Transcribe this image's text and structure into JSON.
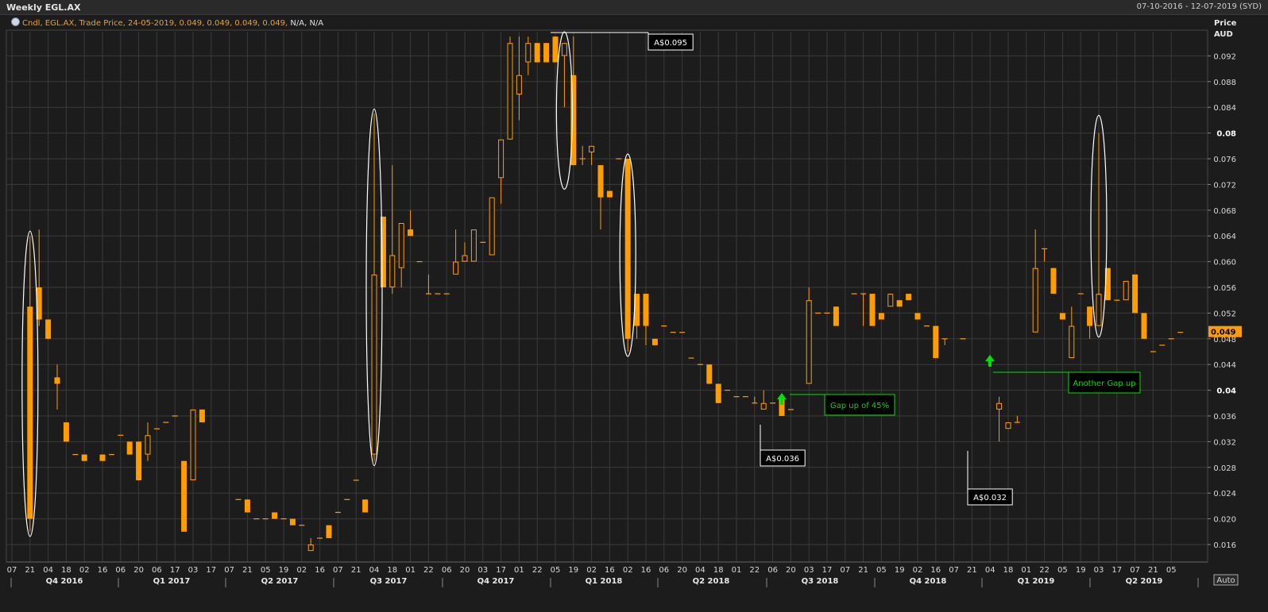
{
  "window": {
    "title": "Weekly EGL.AX",
    "date_range": "07-10-2016 - 12-07-2019 (SYD)"
  },
  "legend": {
    "icon": "chart-settings-icon",
    "series_text": "Cndl, EGL.AX, Trade Price, 24-05-2019, 0.049, 0.049, 0.049, 0.049,",
    "na_text": " N/A, N/A"
  },
  "axis": {
    "y_header_1": "Price",
    "y_header_2": "AUD",
    "auto_label": "Auto",
    "last_price_label": "0.049"
  },
  "colors": {
    "background": "#1c1c1c",
    "grid": "#3a3a3a",
    "candle": "#ff9d00",
    "annotation_green": "#00e000",
    "annotation_white": "#ffffff"
  },
  "chart_data": {
    "type": "candlestick",
    "title": "Weekly EGL.AX",
    "ylabel": "Price AUD",
    "ylim": [
      0.014,
      0.096
    ],
    "yticks": [
      0.016,
      0.02,
      0.024,
      0.028,
      0.032,
      0.036,
      0.04,
      0.044,
      0.048,
      0.052,
      0.056,
      0.06,
      0.064,
      0.068,
      0.072,
      0.076,
      0.08,
      0.084,
      0.088,
      0.092
    ],
    "yticks_bold": [
      0.04,
      0.08
    ],
    "grid": true,
    "xticks": [
      "07",
      "21",
      "04",
      "18",
      "02",
      "16",
      "06",
      "20",
      "06",
      "17",
      "03",
      "17",
      "07",
      "21",
      "05",
      "19",
      "02",
      "16",
      "07",
      "21",
      "04",
      "18",
      "01",
      "22",
      "06",
      "20",
      "03",
      "17",
      "01",
      "22",
      "05",
      "19",
      "02",
      "16",
      "02",
      "16",
      "06",
      "20",
      "04",
      "18",
      "01",
      "22",
      "06",
      "20",
      "03",
      "17",
      "07",
      "21",
      "05",
      "19",
      "02",
      "16",
      "07",
      "21",
      "04",
      "18",
      "01",
      "22",
      "05",
      "19",
      "03",
      "17",
      "07",
      "21",
      "05"
    ],
    "quarters": [
      "Q4 2016",
      "Q1 2017",
      "Q2 2017",
      "Q3 2017",
      "Q4 2017",
      "Q1 2018",
      "Q2 2018",
      "Q3 2018",
      "Q4 2018",
      "Q1 2019",
      "Q2 2019"
    ],
    "candles": [
      [
        2,
        0.053,
        0.064,
        0.018,
        0.02
      ],
      [
        3,
        0.056,
        0.065,
        0.05,
        0.051
      ],
      [
        4,
        0.051,
        0.051,
        0.048,
        0.048
      ],
      [
        5,
        0.042,
        0.044,
        0.037,
        0.041
      ],
      [
        6,
        0.035,
        0.035,
        0.032,
        0.032
      ],
      [
        7,
        0.03,
        0.03,
        0.03,
        0.03
      ],
      [
        8,
        0.03,
        0.03,
        0.029,
        0.029
      ],
      [
        10,
        0.03,
        0.03,
        0.029,
        0.029
      ],
      [
        11,
        0.03,
        0.03,
        0.03,
        0.03
      ],
      [
        12,
        0.033,
        0.033,
        0.033,
        0.033
      ],
      [
        13,
        0.032,
        0.032,
        0.03,
        0.03
      ],
      [
        14,
        0.032,
        0.032,
        0.026,
        0.026
      ],
      [
        15,
        0.03,
        0.035,
        0.029,
        0.033
      ],
      [
        16,
        0.034,
        0.034,
        0.034,
        0.034
      ],
      [
        17,
        0.035,
        0.035,
        0.035,
        0.035
      ],
      [
        18,
        0.036,
        0.036,
        0.036,
        0.036
      ],
      [
        19,
        0.029,
        0.029,
        0.018,
        0.018
      ],
      [
        20,
        0.026,
        0.037,
        0.026,
        0.037
      ],
      [
        21,
        0.037,
        0.037,
        0.035,
        0.035
      ],
      [
        25,
        0.023,
        0.023,
        0.023,
        0.023
      ],
      [
        26,
        0.023,
        0.023,
        0.021,
        0.021
      ],
      [
        27,
        0.02,
        0.02,
        0.02,
        0.02
      ],
      [
        28,
        0.02,
        0.02,
        0.02,
        0.02
      ],
      [
        29,
        0.021,
        0.021,
        0.02,
        0.02
      ],
      [
        30,
        0.02,
        0.02,
        0.02,
        0.02
      ],
      [
        31,
        0.02,
        0.02,
        0.019,
        0.019
      ],
      [
        32,
        0.019,
        0.019,
        0.019,
        0.019
      ],
      [
        33,
        0.015,
        0.017,
        0.015,
        0.016
      ],
      [
        34,
        0.017,
        0.017,
        0.017,
        0.017
      ],
      [
        35,
        0.019,
        0.019,
        0.017,
        0.017
      ],
      [
        36,
        0.021,
        0.021,
        0.021,
        0.021
      ],
      [
        37,
        0.023,
        0.023,
        0.023,
        0.023
      ],
      [
        38,
        0.026,
        0.026,
        0.026,
        0.026
      ],
      [
        39,
        0.023,
        0.023,
        0.021,
        0.021
      ],
      [
        40,
        0.03,
        0.083,
        0.029,
        0.058
      ],
      [
        41,
        0.067,
        0.067,
        0.056,
        0.056
      ],
      [
        42,
        0.056,
        0.075,
        0.055,
        0.061
      ],
      [
        43,
        0.059,
        0.066,
        0.056,
        0.066
      ],
      [
        44,
        0.065,
        0.068,
        0.064,
        0.064
      ],
      [
        45,
        0.06,
        0.06,
        0.06,
        0.06
      ],
      [
        46,
        0.055,
        0.058,
        0.055,
        0.055
      ],
      [
        47,
        0.055,
        0.055,
        0.055,
        0.055
      ],
      [
        48,
        0.055,
        0.055,
        0.055,
        0.055
      ],
      [
        49,
        0.058,
        0.065,
        0.058,
        0.06
      ],
      [
        50,
        0.06,
        0.063,
        0.06,
        0.061
      ],
      [
        51,
        0.06,
        0.065,
        0.06,
        0.065
      ],
      [
        52,
        0.063,
        0.063,
        0.063,
        0.063
      ],
      [
        53,
        0.061,
        0.07,
        0.061,
        0.07
      ],
      [
        54,
        0.073,
        0.079,
        0.069,
        0.079
      ],
      [
        55,
        0.079,
        0.095,
        0.079,
        0.094
      ],
      [
        56,
        0.086,
        0.095,
        0.082,
        0.089
      ],
      [
        57,
        0.091,
        0.095,
        0.089,
        0.094
      ],
      [
        58,
        0.094,
        0.094,
        0.091,
        0.091
      ],
      [
        59,
        0.094,
        0.094,
        0.091,
        0.091
      ],
      [
        60,
        0.095,
        0.095,
        0.091,
        0.091
      ],
      [
        61,
        0.092,
        0.094,
        0.084,
        0.094
      ],
      [
        62,
        0.089,
        0.095,
        0.075,
        0.075
      ],
      [
        63,
        0.076,
        0.078,
        0.075,
        0.076
      ],
      [
        64,
        0.077,
        0.078,
        0.075,
        0.078
      ],
      [
        65,
        0.075,
        0.075,
        0.065,
        0.07
      ],
      [
        66,
        0.071,
        0.071,
        0.07,
        0.07
      ],
      [
        67,
        0.076,
        0.076,
        0.076,
        0.076
      ],
      [
        68,
        0.076,
        0.076,
        0.046,
        0.048
      ],
      [
        69,
        0.055,
        0.055,
        0.048,
        0.05
      ],
      [
        70,
        0.055,
        0.055,
        0.047,
        0.05
      ],
      [
        71,
        0.048,
        0.048,
        0.047,
        0.047
      ],
      [
        72,
        0.05,
        0.05,
        0.05,
        0.05
      ],
      [
        73,
        0.049,
        0.049,
        0.049,
        0.049
      ],
      [
        74,
        0.049,
        0.049,
        0.049,
        0.049
      ],
      [
        75,
        0.045,
        0.045,
        0.045,
        0.045
      ],
      [
        76,
        0.044,
        0.044,
        0.044,
        0.044
      ],
      [
        77,
        0.044,
        0.044,
        0.041,
        0.041
      ],
      [
        78,
        0.041,
        0.041,
        0.038,
        0.038
      ],
      [
        79,
        0.04,
        0.04,
        0.04,
        0.04
      ],
      [
        80,
        0.039,
        0.039,
        0.039,
        0.039
      ],
      [
        81,
        0.039,
        0.039,
        0.039,
        0.039
      ],
      [
        82,
        0.038,
        0.039,
        0.038,
        0.038
      ],
      [
        83,
        0.037,
        0.04,
        0.037,
        0.038
      ],
      [
        84,
        0.038,
        0.038,
        0.038,
        0.038
      ],
      [
        85,
        0.039,
        0.039,
        0.036,
        0.036
      ],
      [
        86,
        0.037,
        0.037,
        0.037,
        0.037
      ],
      [
        88,
        0.041,
        0.056,
        0.041,
        0.054
      ],
      [
        89,
        0.052,
        0.052,
        0.052,
        0.052
      ],
      [
        90,
        0.052,
        0.052,
        0.052,
        0.052
      ],
      [
        91,
        0.053,
        0.053,
        0.05,
        0.05
      ],
      [
        93,
        0.055,
        0.055,
        0.055,
        0.055
      ],
      [
        94,
        0.055,
        0.055,
        0.05,
        0.055
      ],
      [
        95,
        0.055,
        0.055,
        0.05,
        0.05
      ],
      [
        96,
        0.052,
        0.052,
        0.051,
        0.051
      ],
      [
        97,
        0.053,
        0.055,
        0.053,
        0.055
      ],
      [
        98,
        0.054,
        0.054,
        0.053,
        0.053
      ],
      [
        99,
        0.055,
        0.055,
        0.054,
        0.054
      ],
      [
        100,
        0.052,
        0.052,
        0.051,
        0.051
      ],
      [
        101,
        0.05,
        0.05,
        0.05,
        0.05
      ],
      [
        102,
        0.05,
        0.05,
        0.045,
        0.045
      ],
      [
        103,
        0.048,
        0.048,
        0.047,
        0.048
      ],
      [
        105,
        0.048,
        0.048,
        0.048,
        0.048
      ],
      [
        109,
        0.037,
        0.039,
        0.032,
        0.038
      ],
      [
        110,
        0.034,
        0.035,
        0.034,
        0.035
      ],
      [
        111,
        0.035,
        0.036,
        0.035,
        0.035
      ],
      [
        113,
        0.049,
        0.065,
        0.049,
        0.059
      ],
      [
        114,
        0.062,
        0.062,
        0.06,
        0.062
      ],
      [
        115,
        0.059,
        0.059,
        0.055,
        0.055
      ],
      [
        116,
        0.052,
        0.052,
        0.051,
        0.051
      ],
      [
        117,
        0.045,
        0.053,
        0.045,
        0.05
      ],
      [
        118,
        0.055,
        0.055,
        0.055,
        0.055
      ],
      [
        119,
        0.053,
        0.053,
        0.048,
        0.05
      ],
      [
        120,
        0.05,
        0.08,
        0.05,
        0.055
      ],
      [
        121,
        0.059,
        0.059,
        0.054,
        0.054
      ],
      [
        122,
        0.054,
        0.054,
        0.054,
        0.054
      ],
      [
        123,
        0.054,
        0.057,
        0.054,
        0.057
      ],
      [
        124,
        0.058,
        0.058,
        0.052,
        0.052
      ],
      [
        125,
        0.052,
        0.052,
        0.048,
        0.048
      ],
      [
        126,
        0.046,
        0.046,
        0.046,
        0.046
      ],
      [
        127,
        0.047,
        0.047,
        0.047,
        0.047
      ],
      [
        128,
        0.048,
        0.048,
        0.048,
        0.048
      ],
      [
        129,
        0.049,
        0.049,
        0.049,
        0.049
      ]
    ],
    "annotations": {
      "callouts": [
        "A$0.095",
        "A$0.036",
        "A$0.032"
      ],
      "gap_notes": [
        "Gap up of 45%",
        "Another Gap up"
      ]
    }
  }
}
